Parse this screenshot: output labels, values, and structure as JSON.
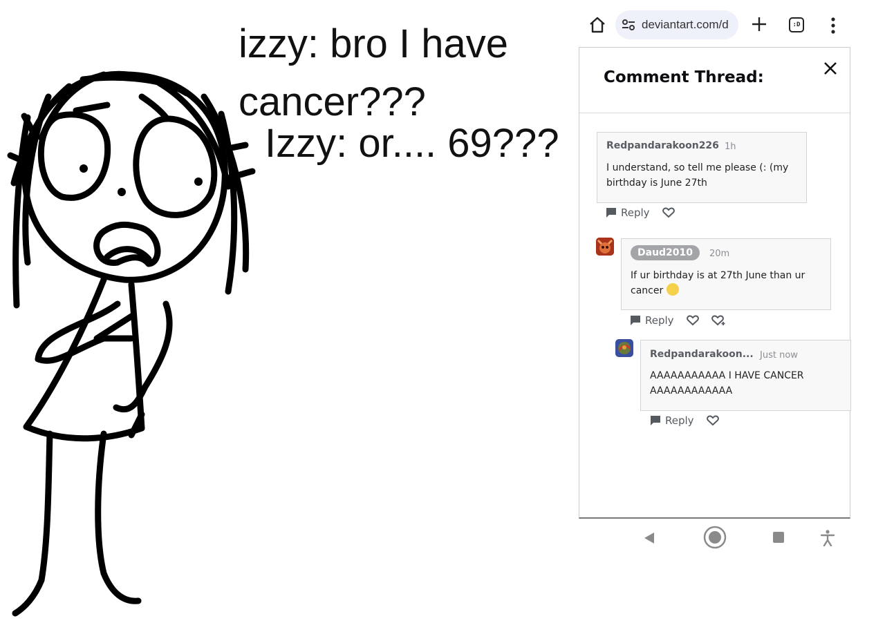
{
  "meme": {
    "caption_1": "izzy: bro I have cancer???",
    "caption_2": "Izzy: or.... 69???"
  },
  "browser": {
    "url": "deviantart.com/d",
    "tabs_icon_label": ":D",
    "icons": [
      "home-icon",
      "site-settings-icon",
      "plus-icon",
      "tabs-icon",
      "more-vert-icon"
    ]
  },
  "thread": {
    "title": "Comment Thread:",
    "reply_label": "Reply",
    "comments": [
      {
        "author": "Redpandarakoon226",
        "time": "1h",
        "text": "I understand, so tell me please (: (my birthday is June 27th"
      },
      {
        "author": "Daud2010",
        "time": "20m",
        "text": "If ur birthday is at 27th June than ur cancer"
      },
      {
        "author": "Redpandarakoon...",
        "time": "Just now",
        "text": "AAAAAAAAAAA I HAVE CANCER AAAAAAAAAAAA"
      }
    ]
  },
  "system_nav": {
    "icons": [
      "back-icon",
      "home-circle-icon",
      "recents-icon",
      "accessibility-icon"
    ]
  },
  "colors": {
    "url_pill_bg": "#eef1fa",
    "author_pill_bg": "#a3a5a8",
    "comment_bg": "#f8f8f8"
  }
}
